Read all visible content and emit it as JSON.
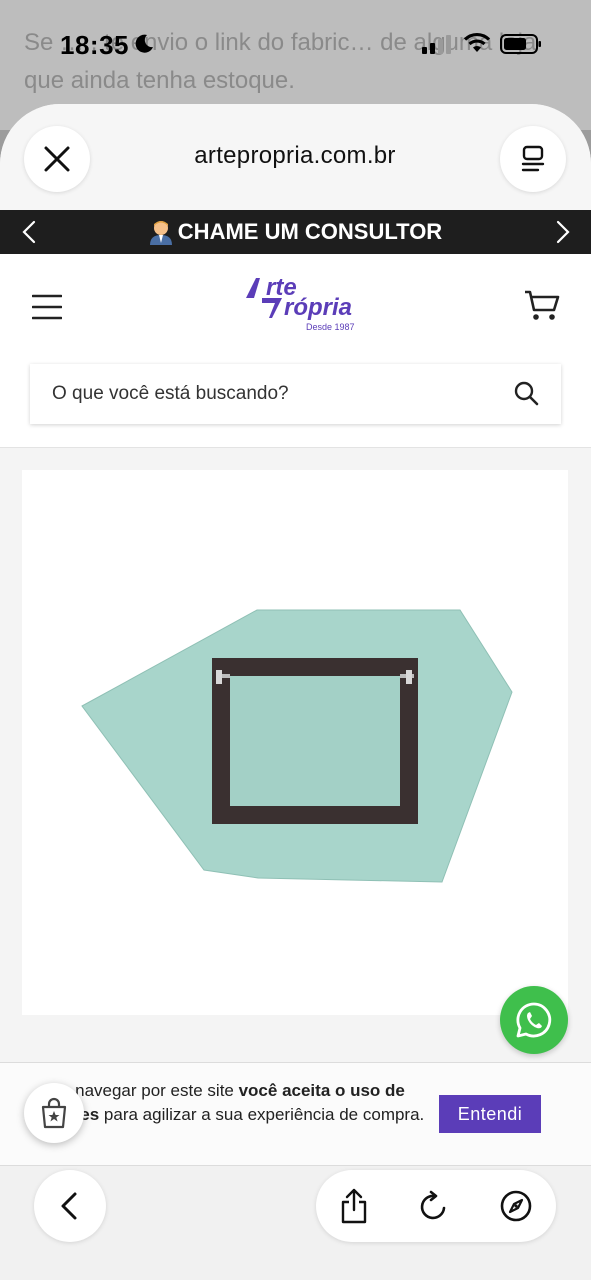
{
  "background_chat": {
    "message": "Se … , te envio o link do fabric… de alguma loja que ainda tenha estoque."
  },
  "status_bar": {
    "time": "18:35",
    "icons": [
      "moon-icon",
      "signal-icon",
      "wifi-icon",
      "battery-icon"
    ]
  },
  "browser": {
    "domain": "artepropria.com.br",
    "close_icon": "close-icon",
    "tabs_icon": "menu-icon"
  },
  "promo_bar": {
    "label": "CHAME UM CONSULTOR",
    "background": "#1e1e1e"
  },
  "site": {
    "logo_line1": "rte",
    "logo_line2": "rópria",
    "logo_since": "Desde 1987",
    "brand_color": "#5b3db8",
    "search_placeholder": "O que você está buscando?"
  },
  "cookie_banner": {
    "text_part1": "navegar por este site ",
    "text_bold1": "você aceita o uso de",
    "text_bold2": "okies",
    "text_part2": " para agilizar a sua experiência de compra.",
    "accept_label": "Entendi"
  },
  "bottom_toolbar": {
    "icons": [
      "back-icon",
      "share-icon",
      "reload-icon",
      "compass-icon"
    ]
  }
}
